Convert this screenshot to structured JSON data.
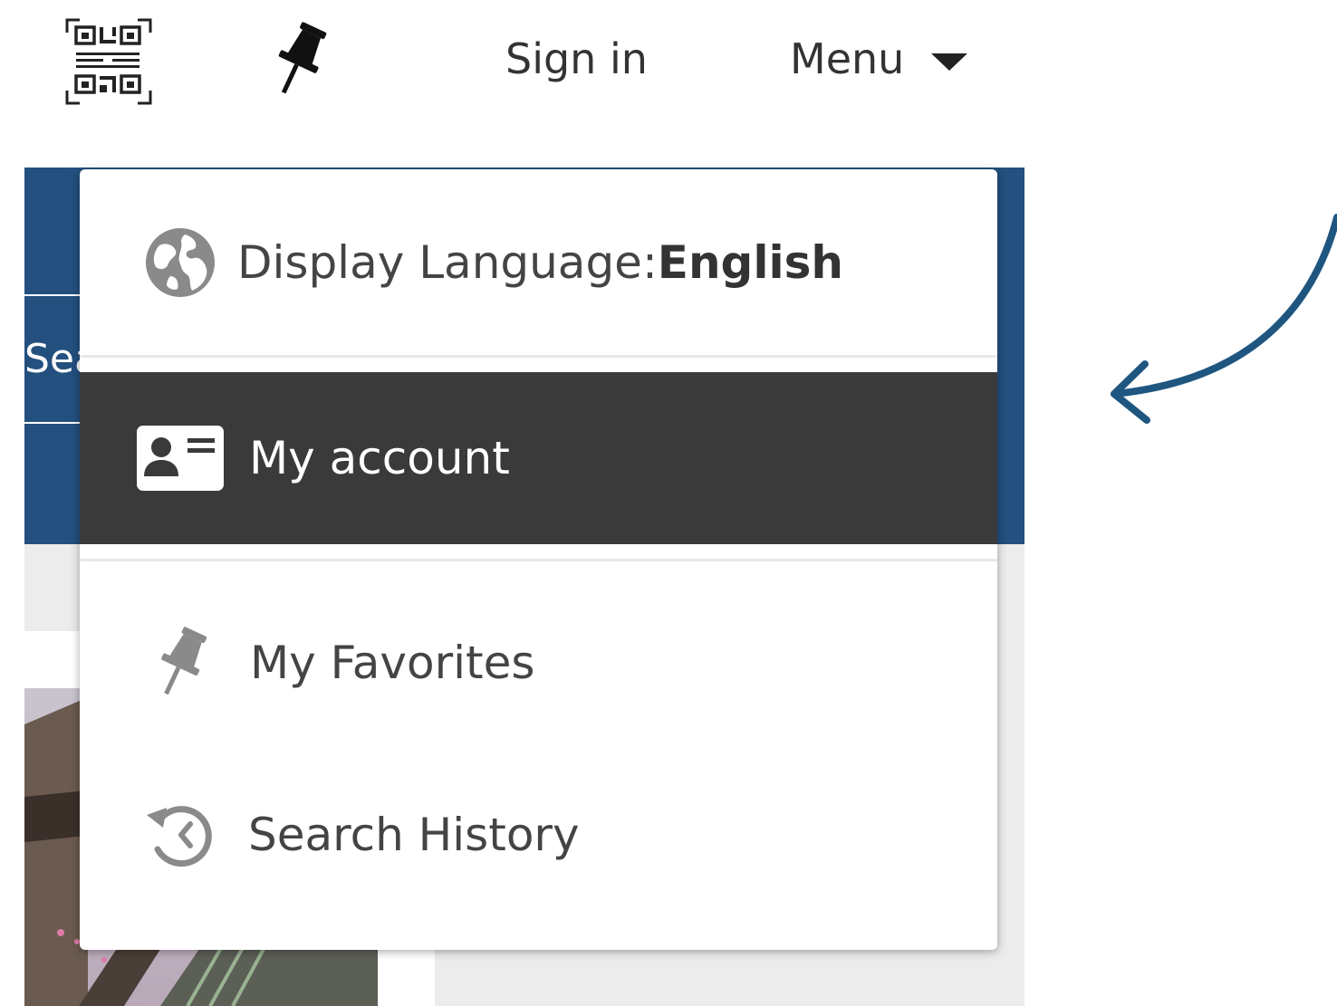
{
  "header": {
    "sign_in_label": "Sign in",
    "menu_label": "Menu",
    "icons": {
      "qr": "qr-code-icon",
      "favorites": "pushpin-icon",
      "menu_caret": "caret-down-icon"
    }
  },
  "background": {
    "search_fragment": "Sea",
    "banner_color": "#23507e"
  },
  "dropdown": {
    "language": {
      "label": "Display Language: ",
      "value": "English",
      "icon": "globe-icon"
    },
    "items": [
      {
        "label": "My account",
        "icon": "id-card-icon",
        "selected": true
      },
      {
        "label": "My Favorites",
        "icon": "pushpin-icon",
        "selected": false
      },
      {
        "label": "Search History",
        "icon": "history-icon",
        "selected": false
      }
    ]
  },
  "colors": {
    "selected_item_bg": "#3a3a3a",
    "annotation_arrow": "#1f5680",
    "icon_gray": "#8a8a8a"
  }
}
